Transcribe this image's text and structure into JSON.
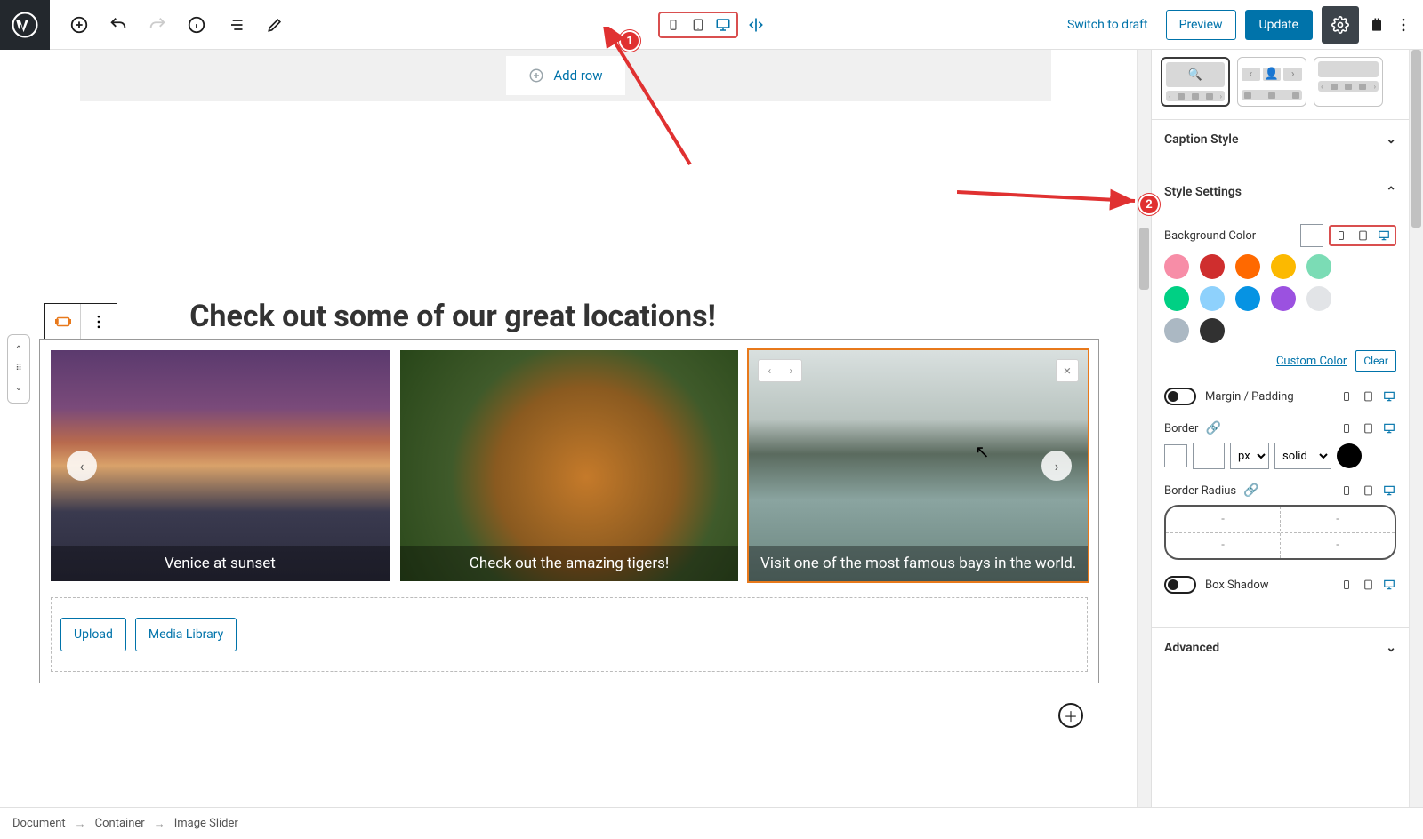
{
  "topbar": {
    "switch_draft": "Switch to draft",
    "preview": "Preview",
    "update": "Update"
  },
  "editor": {
    "add_row": "Add row",
    "heading": "Check out some of our great locations!",
    "slides": [
      {
        "caption": "Venice at sunset"
      },
      {
        "caption": "Check out the amazing tigers!"
      },
      {
        "caption": "Visit one of the most famous bays in the world."
      }
    ],
    "upload": "Upload",
    "media_library": "Media Library"
  },
  "sidebar": {
    "caption_style": "Caption Style",
    "style_settings": "Style Settings",
    "background_color": "Background Color",
    "custom_color": "Custom Color",
    "clear": "Clear",
    "margin_padding": "Margin / Padding",
    "border": "Border",
    "border_unit": "px",
    "border_style": "solid",
    "border_radius": "Border Radius",
    "radius_ph": "-",
    "box_shadow": "Box Shadow",
    "advanced": "Advanced",
    "colors_row1": [
      "#f78da7",
      "#cf2e2e",
      "#ff6900",
      "#fcb900",
      "#7bdcb5"
    ],
    "colors_row2": [
      "#00d084",
      "#8ed1fc",
      "#0693e3",
      "#9b51e0",
      "#e2e4e7"
    ],
    "colors_row3": [
      "#abb8c3",
      "#313131"
    ]
  },
  "breadcrumb": [
    "Document",
    "Container",
    "Image Slider"
  ],
  "callouts": {
    "one": "1",
    "two": "2"
  }
}
